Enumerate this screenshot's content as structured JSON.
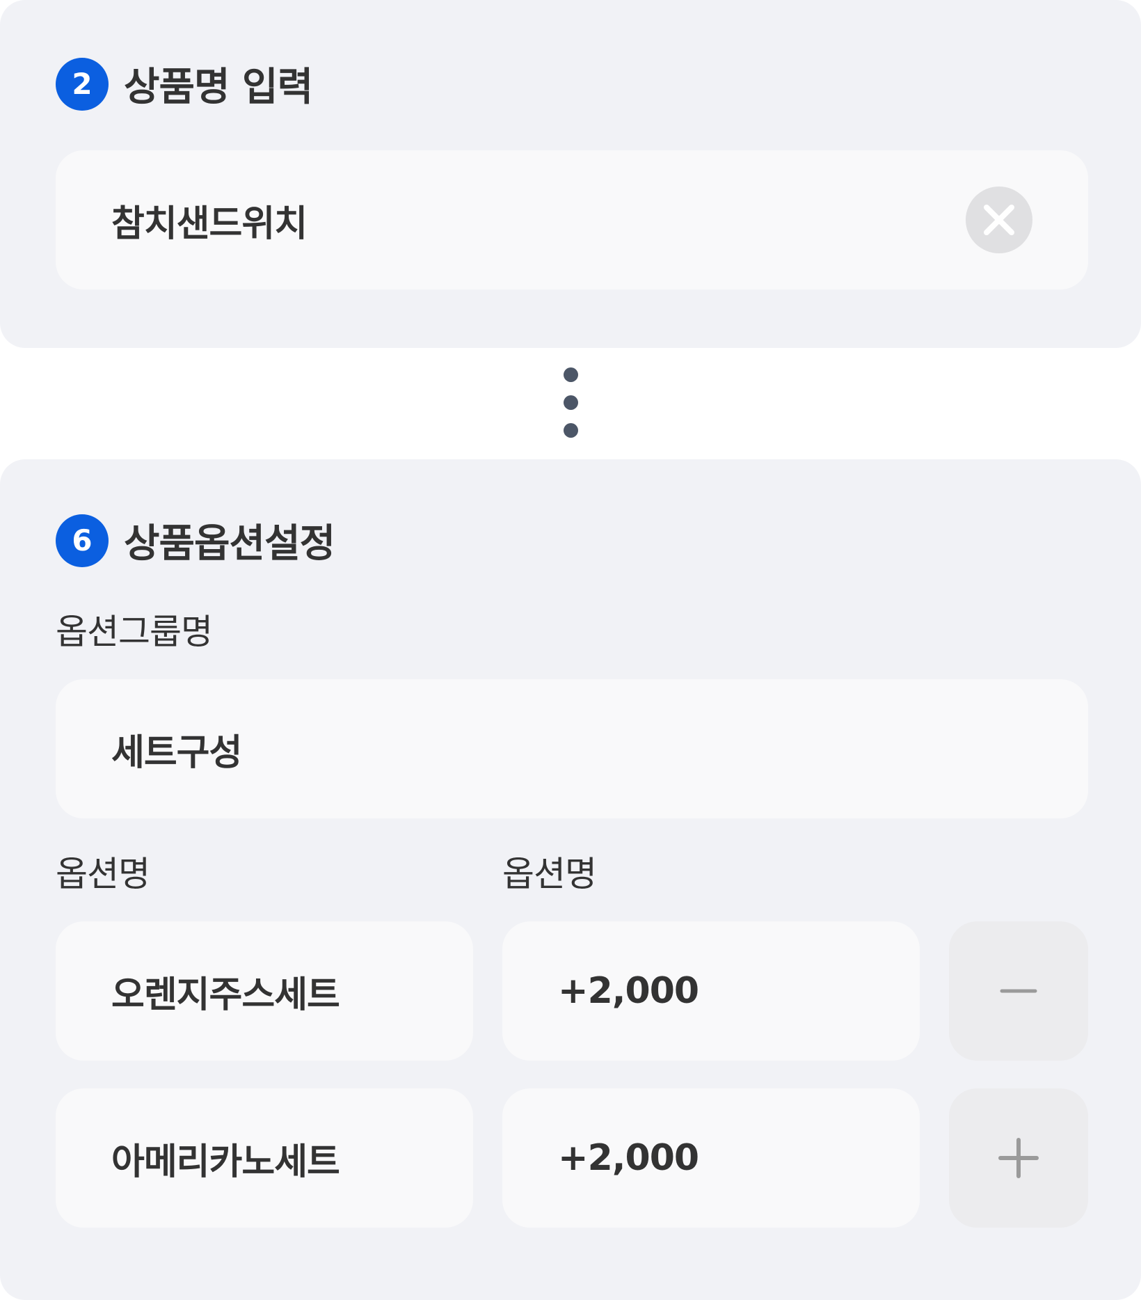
{
  "step_product_name": {
    "number": "2",
    "title": "상품명 입력",
    "input_value": "참치샌드위치"
  },
  "step_options": {
    "number": "6",
    "title": "상품옵션설정",
    "group_label": "옵션그룹명",
    "group_value": "세트구성",
    "name_col_label": "옵션명",
    "price_col_label": "옵션명",
    "rows": [
      {
        "name": "오렌지주스세트",
        "price": "+2,000",
        "action": "remove"
      },
      {
        "name": "아메리카노세트",
        "price": "+2,000",
        "action": "add"
      }
    ]
  },
  "icons": {
    "clear": "close-icon",
    "remove": "minus-icon",
    "add": "plus-icon",
    "separator": "vertical-ellipsis-icon"
  },
  "colors": {
    "accent": "#0b5fe0",
    "card_bg": "#f1f2f6",
    "field_bg": "#f9f9fa",
    "text": "#333333",
    "icon_gray": "#9a9a9a"
  }
}
